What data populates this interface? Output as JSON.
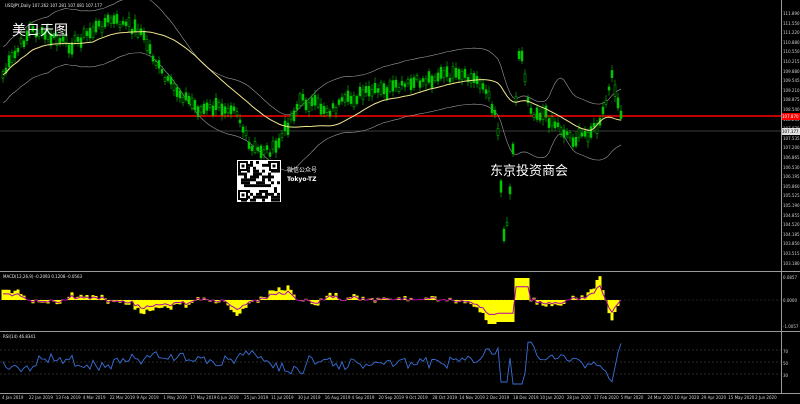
{
  "header": {
    "symbol_line": "USDJPY,Daily  107.262 107.281 107.081 107.177",
    "macd_label": "MACD(12,26,9) -0.2093 0.1208 -0.0563",
    "rsi_label": "RSI(14) 46.8341"
  },
  "watermarks": {
    "top_left": "美日天图",
    "center": "东京投资商会",
    "qr_line1": "微信公众号",
    "qr_line2": "Tokyo-TZ"
  },
  "price_axis": {
    "labels": [
      "111.890",
      "111.550",
      "111.220",
      "110.880",
      "110.550",
      "110.215",
      "109.880",
      "109.545",
      "109.210",
      "108.875",
      "108.540",
      "108.205",
      "107.870",
      "107.535",
      "107.200",
      "106.865",
      "106.530",
      "106.195",
      "105.860",
      "105.525",
      "105.190",
      "104.855",
      "104.520",
      "104.185",
      "103.850",
      "103.515",
      "103.180"
    ],
    "current_price": "107.177",
    "reference_level": "107.870"
  },
  "macd_axis": {
    "labels": [
      "0.0857",
      "0.0000",
      "-1.0057"
    ]
  },
  "rsi_axis": {
    "labels": [
      "70",
      "50",
      "30"
    ]
  },
  "date_axis": {
    "labels": [
      "4 Jan 2019",
      "22 Jan 2019",
      "13 Feb 2019",
      "4 Mar 2019",
      "22 Mar 2019",
      "9 Apr 2019",
      "1 May 2019",
      "17 May 2019",
      "6 Jun 2019",
      "25 Jun 2019",
      "11 Jul 2019",
      "30 Jul 2019",
      "16 Aug 2019",
      "4 Sep 2019",
      "20 Sep 2019",
      "9 Oct 2019",
      "28 Oct 2019",
      "14 Nov 2019",
      "2 Dec 2019",
      "18 Dec 2019",
      "10 Jan 2020",
      "28 Jan 2020",
      "17 Feb 2020",
      "5 Mar 2020",
      "24 Mar 2020",
      "10 Apr 2020",
      "29 Apr 2020",
      "15 May 2020",
      "2 Jun 2020"
    ]
  },
  "colors": {
    "background": "#000000",
    "bull_candle": "#00c800",
    "bear_candle": "#00c800",
    "ma_line": "#f0e68c",
    "bands": "#9a9a9a",
    "hline": "#ff0000",
    "macd_hist": "#ffff00",
    "macd_signal": "#b000b0",
    "rsi_line": "#3a6fd8"
  }
}
